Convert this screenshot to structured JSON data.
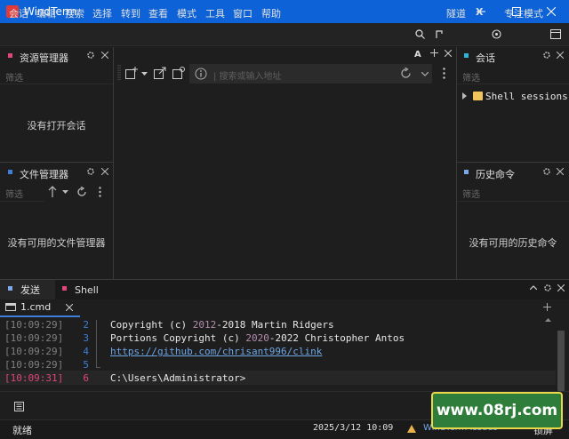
{
  "window": {
    "title": "WindTerm"
  },
  "menu": {
    "items": [
      "会话",
      "编辑",
      "搜索",
      "选择",
      "转到",
      "查看",
      "模式",
      "工具",
      "窗口",
      "帮助"
    ],
    "tunnel_label": "隧道",
    "x_label": "X",
    "focus_mode_label": "专注模式"
  },
  "explorer": {
    "title": "资源管理器",
    "filter_placeholder": "筛选",
    "empty_message": "没有打开会话"
  },
  "file_manager": {
    "title": "文件管理器",
    "filter_placeholder": "筛选",
    "empty_message": "没有可用的文件管理器"
  },
  "address": {
    "placeholder": "| 搜索或输入地址",
    "font_label": "A"
  },
  "sessions": {
    "title": "会话",
    "filter_placeholder": "筛选",
    "tree_item": "Shell sessions"
  },
  "history": {
    "title": "历史命令",
    "filter_placeholder": "筛选",
    "empty_message": "没有可用的历史命令"
  },
  "bottom_tabs": [
    {
      "label": "发送",
      "color": "#7aa8e8"
    },
    {
      "label": "Shell",
      "color": "#e0457b"
    }
  ],
  "terminal": {
    "tab_label": "1.cmd",
    "lines": [
      {
        "time": "[10:09:29]",
        "num": "2",
        "text_a": "Copyright (c) ",
        "year1": "2012",
        "text_b": "-2018 Martin Ridgers"
      },
      {
        "time": "[10:09:29]",
        "num": "3",
        "text_a": "Portions Copyright (c) ",
        "year1": "2020",
        "text_b": "-2022 Christopher Antos"
      },
      {
        "time": "[10:09:29]",
        "num": "4",
        "link": "https://github.com/chrisant996/clink"
      },
      {
        "time": "[10:09:29]",
        "num": "5"
      },
      {
        "time": "[10:09:31]",
        "num": "6",
        "prompt": "C:\\Users\\Administrator>"
      }
    ]
  },
  "status": {
    "ready": "就绪",
    "datetime": "2025/3/12 10:09",
    "brand": "WindTerm Issues",
    "lock_label": "锁屏"
  },
  "watermark": {
    "text": "www.08rj.com"
  },
  "colors": {
    "titlebar": "#0c62d6",
    "accent": "#3d7fd9",
    "active_time": "#e0457b"
  }
}
